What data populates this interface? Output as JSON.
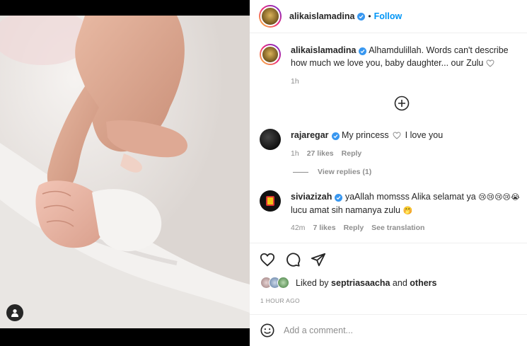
{
  "post": {
    "author": "alikaislamadina",
    "follow_label": "Follow",
    "separator": "•"
  },
  "caption": {
    "username": "alikaislamadina",
    "text": "Alhamdulillah. Words can't describe how much we love you, baby daughter... our Zulu",
    "time": "1h"
  },
  "comments": [
    {
      "username": "rajaregar",
      "text_before": "My princess",
      "text_after": "I love you",
      "time": "1h",
      "likes": "27 likes",
      "reply_label": "Reply",
      "view_replies": "View replies (1)"
    },
    {
      "username": "siviazizah",
      "text_line1": "yaAllah momsss Alika selamat ya",
      "emoji_line1": "😢😢😢😢😭",
      "text_line2": "lucu amat sih namanya zulu",
      "emoji_line2": "🤭",
      "time": "42m",
      "likes": "7 likes",
      "reply_label": "Reply",
      "translate_label": "See translation"
    }
  ],
  "likes": {
    "prefix": "Liked by",
    "first_user": "septriasaacha",
    "conjunction": "and",
    "others": "others"
  },
  "timestamp": "1 HOUR AGO",
  "comment_box": {
    "placeholder": "Add a comment..."
  },
  "icons": {
    "heart": "heart-icon",
    "comment": "comment-icon",
    "share": "share-icon",
    "emoji": "emoji-icon",
    "plus": "plus-circle-icon",
    "user_tag": "user-icon",
    "verified": "verified-badge-icon"
  },
  "colors": {
    "link_blue": "#0095f6",
    "verified_blue": "#3897f0",
    "muted": "#8e8e8e",
    "text": "#262626"
  }
}
